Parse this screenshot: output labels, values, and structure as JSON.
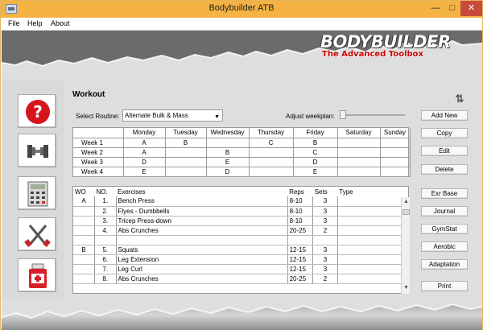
{
  "window": {
    "title": "Bodybuilder ATB"
  },
  "menu": {
    "file": "File",
    "help": "Help",
    "about": "About"
  },
  "banner": {
    "logo": "BODYBUILDER",
    "tagline": "The Advanced Toolbox"
  },
  "side_icons": [
    {
      "name": "help-icon"
    },
    {
      "name": "dumbbell-icon"
    },
    {
      "name": "calculator-icon"
    },
    {
      "name": "fork-knife-icon"
    },
    {
      "name": "medical-icon"
    }
  ],
  "workout": {
    "title": "Workout",
    "routine_label": "Select Routine:",
    "routine_value": "Alternate Bulk & Mass",
    "adjust_label": "Adjust weekplan:"
  },
  "schedule": {
    "headers": [
      "",
      "Monday",
      "Tuesday",
      "Wednesday",
      "Thursday",
      "Friday",
      "Saturday",
      "Sunday"
    ],
    "rows": [
      [
        "Week 1",
        "A",
        "B",
        "",
        "C",
        "B",
        "",
        ""
      ],
      [
        "Week 2",
        "A",
        "",
        "B",
        "",
        "C",
        "",
        ""
      ],
      [
        "Week 3",
        "D",
        "",
        "E",
        "",
        "D",
        "",
        ""
      ],
      [
        "Week 4",
        "E",
        "",
        "D",
        "",
        "E",
        "",
        ""
      ]
    ]
  },
  "exercises": {
    "headers": [
      "WO",
      "NO.",
      "Exercises",
      "Reps",
      "Sets",
      "Type"
    ],
    "rows": [
      [
        "A",
        "1.",
        "Bench Press",
        "8-10",
        "3",
        ""
      ],
      [
        "",
        "2.",
        "Flyes - Dumbbells",
        "8-10",
        "3",
        ""
      ],
      [
        "",
        "3.",
        "Tricep Press-down",
        "8-10",
        "3",
        ""
      ],
      [
        "",
        "4.",
        "Abs Crunches",
        "20-25",
        "2",
        ""
      ],
      [
        "",
        "",
        "",
        "",
        "",
        ""
      ],
      [
        "B",
        "5.",
        "Squats",
        "12-15",
        "3",
        ""
      ],
      [
        "",
        "6.",
        "Leg Extension",
        "12-15",
        "3",
        ""
      ],
      [
        "",
        "7.",
        "Leg Curl",
        "12-15",
        "3",
        ""
      ],
      [
        "",
        "8.",
        "Abs Crunches",
        "20-25",
        "2",
        ""
      ]
    ]
  },
  "buttons": {
    "add_new": "Add New",
    "copy": "Copy",
    "edit": "Edit",
    "delete": "Delete",
    "exr_base": "Exr Base",
    "journal": "Journal",
    "gymstat": "GymStat",
    "aerobic": "Aerobic",
    "adaptation": "Adaptation",
    "print": "Print"
  }
}
